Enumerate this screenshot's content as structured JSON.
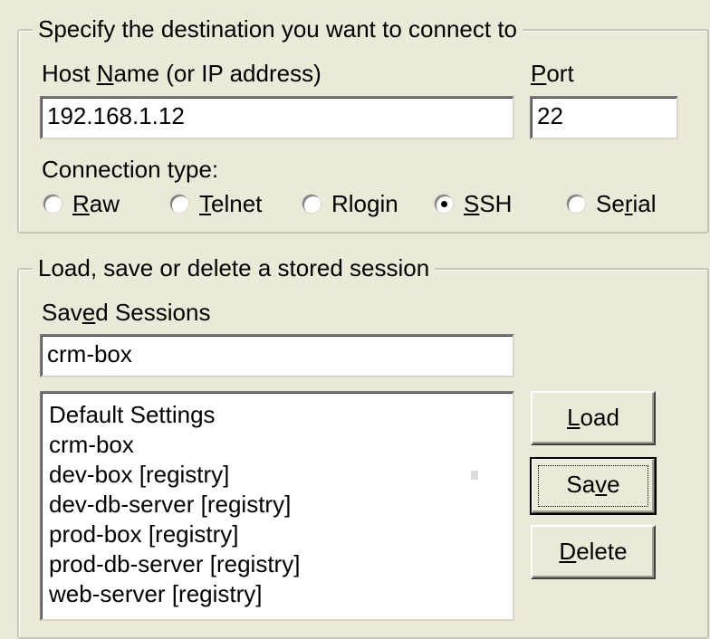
{
  "destination": {
    "title": "Specify the destination you want to connect to",
    "host_label_pre": "Host ",
    "host_label_accel": "N",
    "host_label_post": "ame (or IP address)",
    "host_value": "192.168.1.12",
    "port_label_accel": "P",
    "port_label_post": "ort",
    "port_value": "22",
    "connection_type_label": "Connection type:",
    "connection_types": [
      {
        "accel": "R",
        "rest": "aw",
        "checked": false
      },
      {
        "accel": "T",
        "rest": "elnet",
        "checked": false
      },
      {
        "pre": "Rlo",
        "accel": "g",
        "rest": "in",
        "checked": false
      },
      {
        "accel": "S",
        "rest": "SH",
        "checked": true
      },
      {
        "pre": "Se",
        "accel": "r",
        "rest": "ial",
        "checked": false
      }
    ]
  },
  "sessions": {
    "title": "Load, save or delete a stored session",
    "saved_label_pre": "Sav",
    "saved_label_accel": "e",
    "saved_label_post": "d Sessions",
    "saved_value": "crm-box",
    "list": [
      "Default Settings",
      "crm-box",
      "dev-box [registry]",
      "dev-db-server [registry]",
      "prod-box [registry]",
      "prod-db-server [registry]",
      "web-server [registry]"
    ],
    "buttons": {
      "load_accel": "L",
      "load_rest": "oad",
      "save_pre": "Sa",
      "save_accel": "v",
      "save_rest": "e",
      "delete_accel": "D",
      "delete_rest": "elete"
    }
  }
}
